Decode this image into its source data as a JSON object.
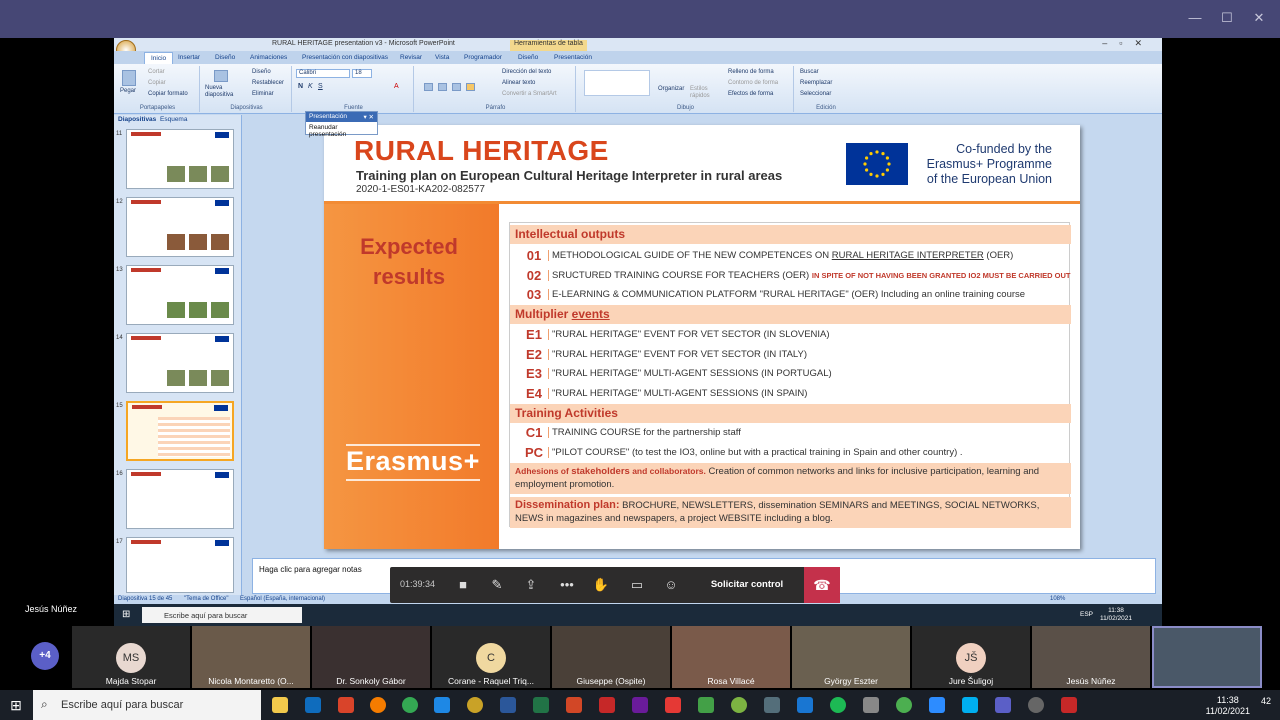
{
  "teams": {
    "presenter_name": "Jesús Núñez",
    "window_controls": [
      "—",
      "☐",
      "✕"
    ]
  },
  "ppt": {
    "window_title": "RURAL HERITAGE presentation v3 - Microsoft PowerPoint",
    "context_tab": "Herramientas de tabla",
    "tabs": [
      "Inicio",
      "Insertar",
      "Diseño",
      "Animaciones",
      "Presentación con diapositivas",
      "Revisar",
      "Vista",
      "Programador",
      "Diseño",
      "Presentación"
    ],
    "ribbon": {
      "paste": "Pegar",
      "cut": "Cortar",
      "copy": "Copiar",
      "format_painter": "Copiar formato",
      "clipboard_group": "Portapapeles",
      "new_slide": "Nueva diapositiva",
      "layout": "Diseño",
      "reset": "Restablecer",
      "delete": "Eliminar",
      "slides_group": "Diapositivas",
      "font_name": "Calibri",
      "font_size": "18",
      "font_group": "Fuente",
      "text_direction": "Dirección del texto",
      "align_text": "Alinear texto",
      "smartart": "Convertir a SmartArt",
      "paragraph_group": "Párrafo",
      "arrange": "Organizar",
      "quick_styles": "Estilos rápidos",
      "shape_fill": "Relleno de forma",
      "shape_outline": "Contorno de forma",
      "shape_effects": "Efectos de forma",
      "drawing_group": "Dibujo",
      "find": "Buscar",
      "replace": "Reemplazar",
      "select": "Seleccionar",
      "editing_group": "Edición"
    },
    "pane_tabs": [
      "Diapositivas",
      "Esquema"
    ],
    "thumb_numbers": [
      "11",
      "12",
      "13",
      "14",
      "15",
      "16",
      "17"
    ],
    "present_bar_title": "Presentación",
    "present_bar_resume": "Reanudar presentación",
    "notes_placeholder": "Haga clic para agregar notas",
    "status_left": "Diapositiva 15 de 45",
    "status_theme": "\"Tema de Office\"",
    "status_lang": "Español (España, internacional)",
    "zoom": "108%"
  },
  "slide": {
    "title": "RURAL HERITAGE",
    "subtitle": "Training plan on European Cultural Heritage Interpreter in rural areas",
    "code": "2020-1-ES01-KA202-082577",
    "cofunded_1": "Co-funded by the",
    "cofunded_2": "Erasmus+ Programme",
    "cofunded_3": "of the European Union",
    "expected_1": "Expected",
    "expected_2": "results",
    "erasmus": "Erasmus+",
    "sec_outputs": "Intellectual outputs",
    "o1_code": "01",
    "o1_text_a": "METHODOLOGICAL GUIDE OF THE NEW COMPETENCES ON ",
    "o1_text_b": "RURAL HERITAGE INTERPRETER",
    "o1_text_c": " (OER)",
    "o2_code": "02",
    "o2_text": "SRUCTURED TRAINING COURSE FOR TEACHERS (OER) ",
    "o2_note": "IN SPITE OF NOT HAVING BEEN GRANTED IO2 MUST BE CARRIED OUT",
    "o3_code": "03",
    "o3_text": "E-LEARNING & COMMUNICATION PLATFORM  \"RURAL HERITAGE\" (OER) Including an online training course",
    "sec_events_a": "Multiplier ",
    "sec_events_b": "events",
    "e1_code": "E1",
    "e1_text": "\"RURAL HERITAGE\" EVENT FOR VET SECTOR (IN SLOVENIA)",
    "e2_code": "E2",
    "e2_text": "\"RURAL HERITAGE\" EVENT FOR VET SECTOR (IN ITALY)",
    "e3_code": "E3",
    "e3_text": "\"RURAL HERITAGE\" MULTI-AGENT SESSIONS (IN PORTUGAL)",
    "e4_code": "E4",
    "e4_text": "\"RURAL HERITAGE\" MULTI-AGENT SESSIONS (IN SPAIN)",
    "sec_training": "Training Activities",
    "c1_code": "C1",
    "c1_text": "TRAINING COURSE for the partnership staff",
    "pc_code": "PC",
    "pc_text": "\"PILOT COURSE\" (to test the IO3, online but with a practical training in Spain and other country) .",
    "adhesions_a": "Adhesions of ",
    "adhesions_b": "stakeholders",
    "adhesions_c": " and collaborators.",
    "adhesions_d": " Creation of common networks and links for inclusive participation, learning and employment promotion.",
    "dissemination_a": "Dissemination plan:",
    "dissemination_b": " BROCHURE, NEWSLETTERS, dissemination SEMINARS and MEETINGS, SOCIAL NETWORKS, NEWS in magazines and newspapers, a project WEBSITE including a blog."
  },
  "call": {
    "timer": "01:39:34",
    "request_control": "Solicitar control"
  },
  "inner_taskbar": {
    "search": "Escribe aquí para buscar",
    "lang": "ESP",
    "time": "11:38",
    "date": "11/02/2021"
  },
  "participants": {
    "more": "+4",
    "list": [
      {
        "initials": "MS",
        "name": "Majda Stopar"
      },
      {
        "initials": "",
        "name": "Nicola Montaretto (O..."
      },
      {
        "initials": "",
        "name": "Dr. Sonkoly Gábor"
      },
      {
        "initials": "C",
        "name": "Corane - Raquel Triq..."
      },
      {
        "initials": "",
        "name": "Giuseppe (Ospite)"
      },
      {
        "initials": "",
        "name": "Rosa Villacé"
      },
      {
        "initials": "",
        "name": "György Eszter"
      },
      {
        "initials": "JŠ",
        "name": "Jure Šuligoj"
      },
      {
        "initials": "",
        "name": "Jesús Núñez"
      }
    ]
  },
  "taskbar": {
    "search": "Escribe aquí para buscar",
    "time": "11:38",
    "date": "11/02/2021",
    "notif_count": "42"
  },
  "colors": {
    "teams_purple": "#464775",
    "accent_orange": "#f27a2a",
    "title_red": "#d9461c",
    "hangup_red": "#c4314b"
  }
}
